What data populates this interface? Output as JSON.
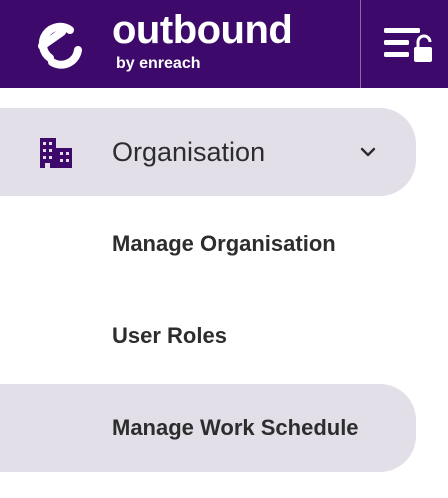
{
  "header": {
    "brand_name": "outbound",
    "brand_sub": "by enreach",
    "logo_icon": "outbound-logo-icon",
    "menu_toggle_icon": "menu-unlock-icon",
    "colors": {
      "background": "#3d0a6b",
      "text": "#ffffff"
    }
  },
  "nav": {
    "section": {
      "label": "Organisation",
      "icon": "buildings-icon",
      "expanded": true,
      "chevron_icon": "chevron-down-icon"
    },
    "items": [
      {
        "label": "Manage Organisation",
        "active": false
      },
      {
        "label": "User Roles",
        "active": false
      },
      {
        "label": "Manage Work Schedule",
        "active": true
      }
    ],
    "colors": {
      "highlight": "#e3dfe9",
      "icon": "#3d0a6b",
      "text": "#2d2d2d"
    }
  }
}
